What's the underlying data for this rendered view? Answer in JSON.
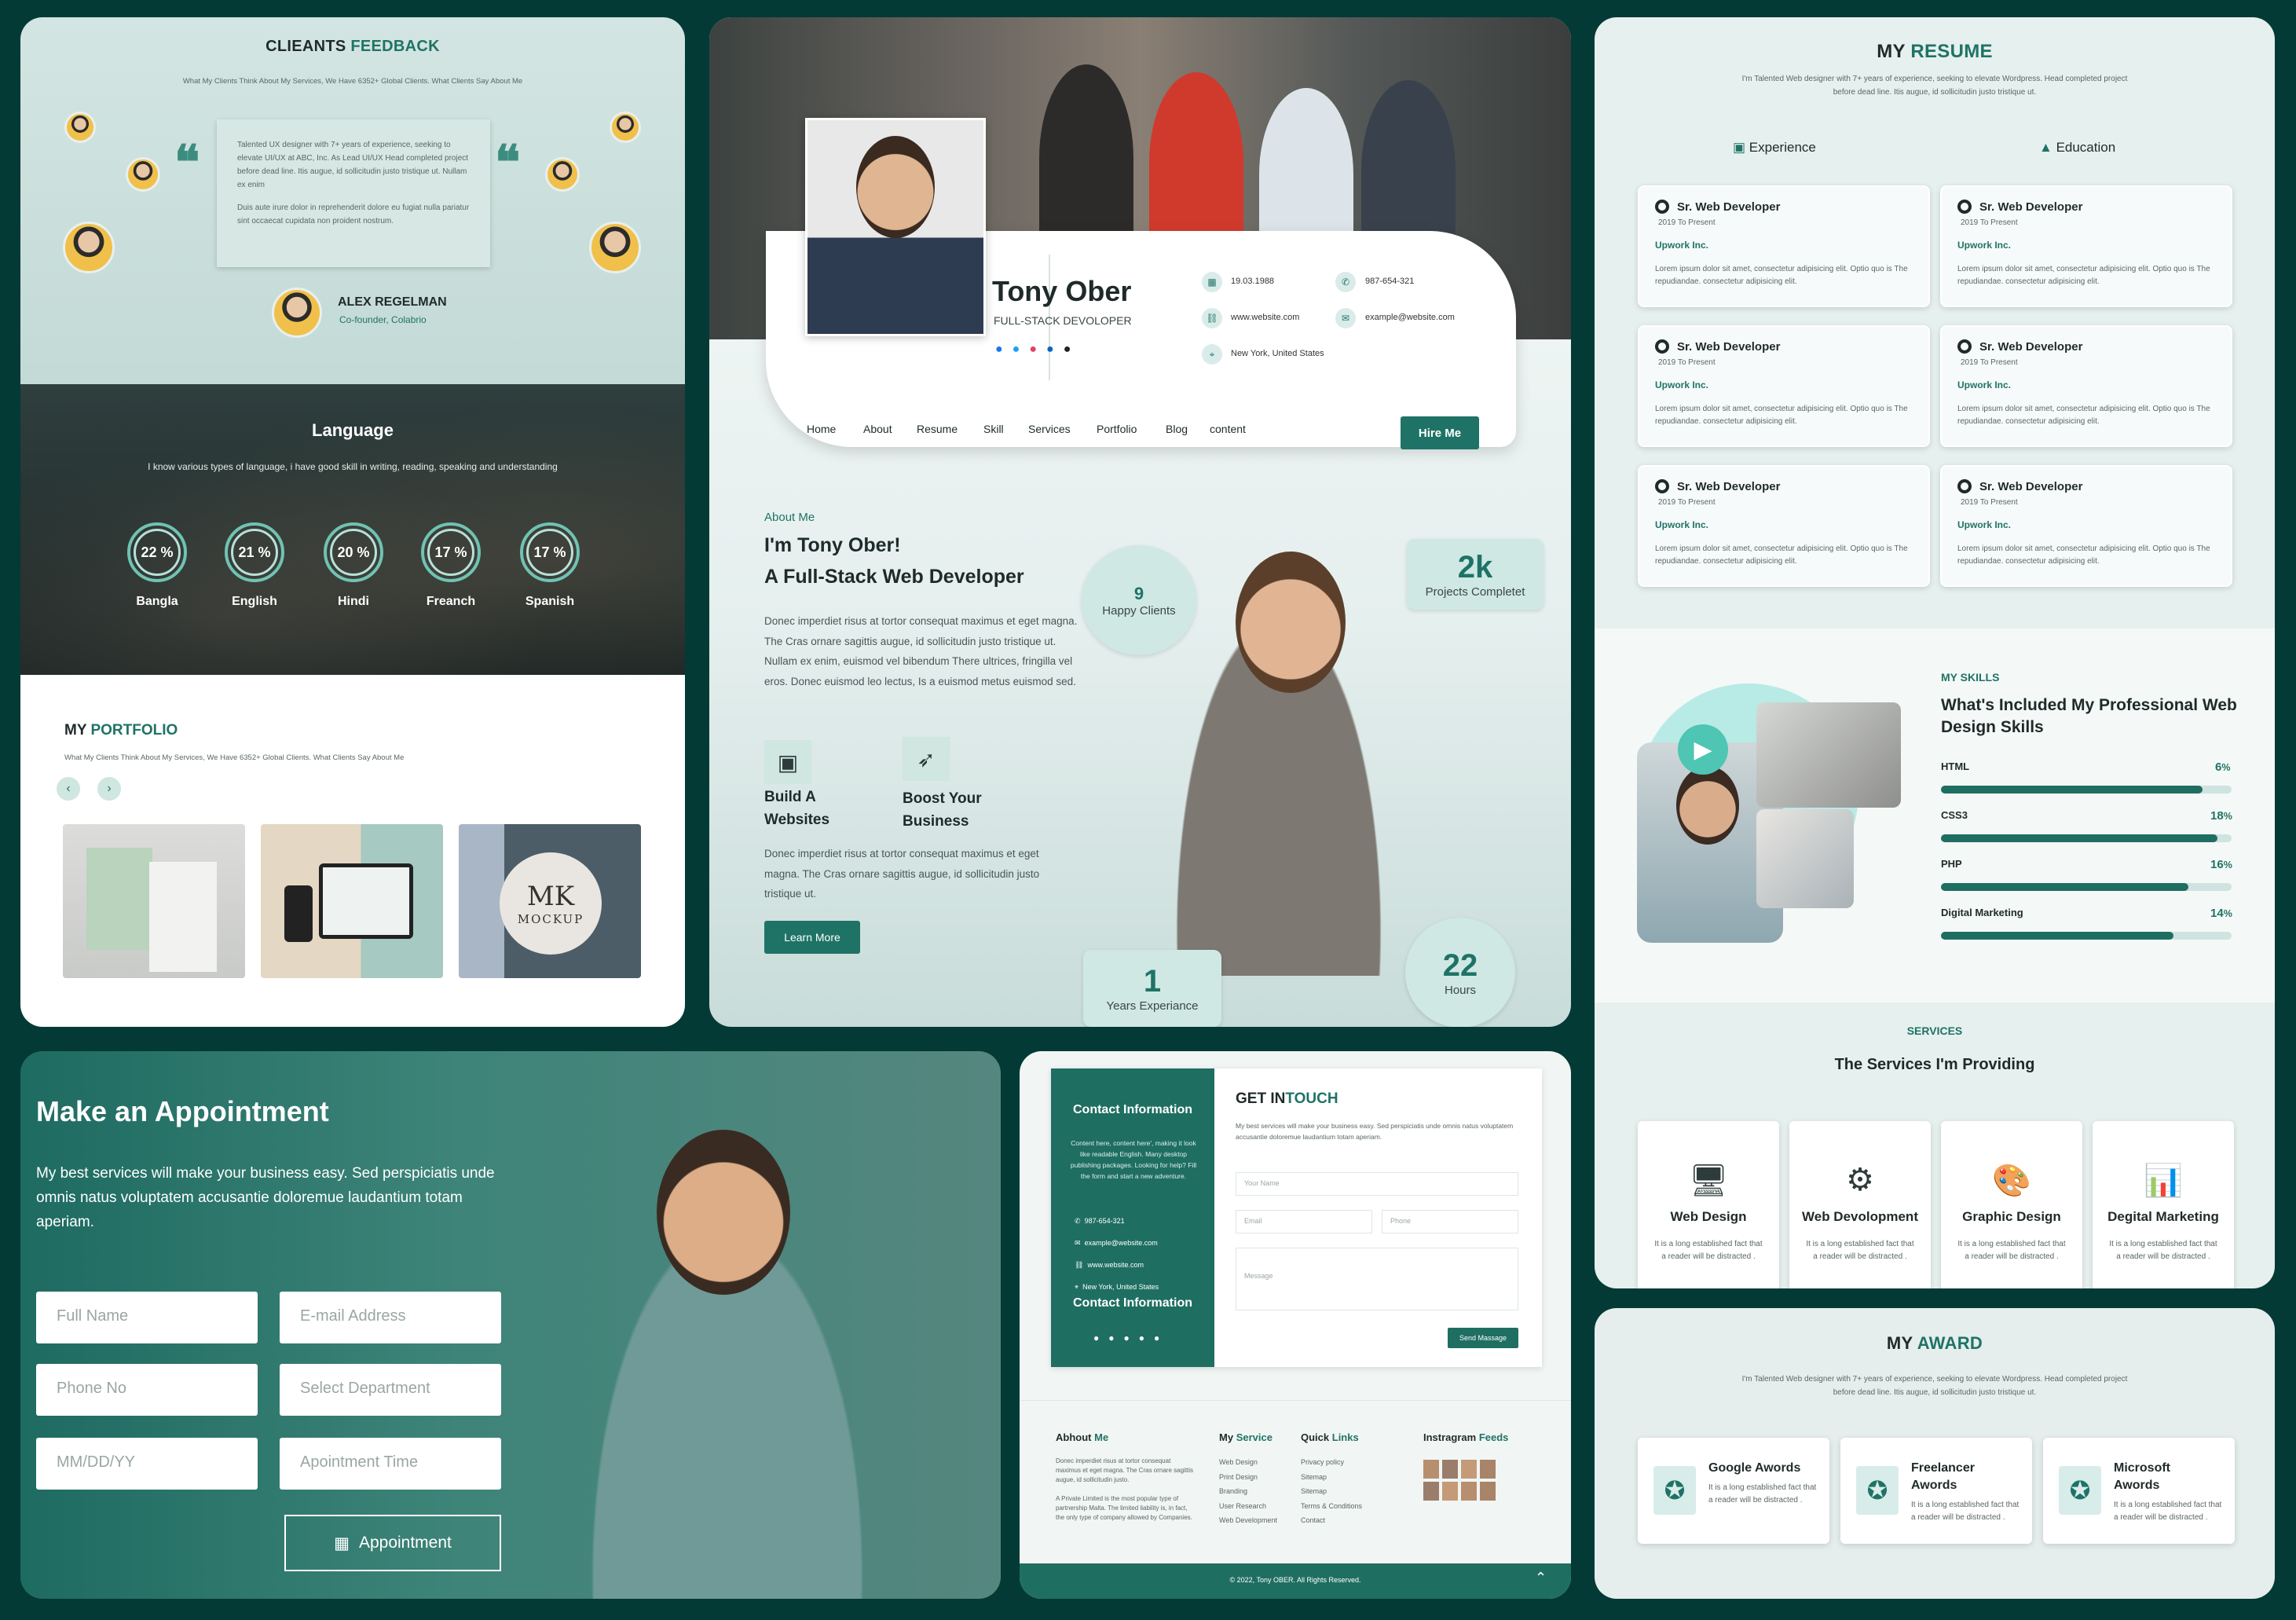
{
  "feedback": {
    "title_a": "CLIEANTS",
    "title_b": "FEEDBACK",
    "subtitle": "What My Clients Think About My Services, We Have 6352+ Global Clients. What Clients Say About Me",
    "quote_p1": "Talented UX designer with 7+ years of experience, seeking to elevate UI/UX at ABC, Inc. As Lead UI/UX Head completed project before dead line. Itis augue, id sollicitudin justo tristique ut. Nullam ex enim",
    "quote_p2": "Duis aute irure dolor in reprehenderit dolore eu fugiat nulla pariatur sint occaecat cupidata non proident nostrum.",
    "author": "ALEX REGELMAN",
    "author_role": "Co-founder, Colabrio"
  },
  "language": {
    "title": "Language",
    "subtitle": "I know various types of language, i have good skill in writing, reading, speaking and understanding",
    "items": [
      {
        "label": "Bangla",
        "value": "22 %"
      },
      {
        "label": "English",
        "value": "21 %"
      },
      {
        "label": "Hindi",
        "value": "20 %"
      },
      {
        "label": "Freanch",
        "value": "17 %"
      },
      {
        "label": "Spanish",
        "value": "17 %"
      }
    ]
  },
  "portfolio": {
    "title_a": "MY",
    "title_b": "PORTFOLIO",
    "subtitle": "What My Clients Think About My Services, We Have 6352+ Global Clients. What Clients Say About Me",
    "prev": "‹",
    "next": "›",
    "mockup_text": "MK",
    "mockup_sub": "MOCKUP"
  },
  "profile": {
    "name": "Tony Ober",
    "role": "FULL-STACK DEVOLOPER",
    "dob": "19.03.1988",
    "phone": "987-654-321",
    "website": "www.website.com",
    "email": "example@website.com",
    "location": "New York, United States",
    "nav": [
      "Home",
      "About",
      "Resume",
      "Skill",
      "Services",
      "Portfolio",
      "Blog",
      "content"
    ],
    "hire": "Hire Me"
  },
  "about": {
    "label": "About Me",
    "heading1": "I'm Tony Ober!",
    "heading2": "A Full-Stack Web Developer",
    "para": "Donec imperdiet risus at tortor consequat maximus et eget magna. The Cras ornare sagittis augue, id sollicitudin justo tristique ut. Nullam ex enim, euismod vel bibendum There ultrices, fringilla vel eros. Donec euismod leo lectus, Is a euismod metus euismod sed.",
    "feat1": "Build A Websites",
    "feat2": "Boost Your Business",
    "para2": "Donec imperdiet risus at tortor consequat maximus et eget magna. The Cras ornare sagittis augue, id sollicitudin justo tristique ut.",
    "learn": "Learn More",
    "stats": [
      {
        "n": "9",
        "l": "Happy Clients"
      },
      {
        "n": "2k",
        "l": "Projects Completet"
      },
      {
        "n": "1",
        "l": "Years Experiance"
      },
      {
        "n": "22",
        "l": "Hours"
      }
    ]
  },
  "resume": {
    "title_a": "MY",
    "title_b": "RESUME",
    "subtitle": "I'm Talented Web designer with 7+ years of experience, seeking to elevate Wordpress. Head completed project before dead line. Itis augue, id sollicitudin justo tristique ut.",
    "tab_exp": "Experience",
    "tab_edu": "Education",
    "card_title": "Sr. Web Developer",
    "card_date": "2019 To Present",
    "card_company": "Upwork Inc.",
    "card_text": "Lorem ipsum dolor sit amet, consectetur adipisicing elit. Optio quo is The repudiandae. consectetur adipisicing elit."
  },
  "skills": {
    "label": "MY SKILLS",
    "heading": "What's Included My Professional Web Design Skills",
    "items": [
      {
        "name": "HTML",
        "pct": "6",
        "fill": 0.9
      },
      {
        "name": "CSS3",
        "pct": "18",
        "fill": 0.95
      },
      {
        "name": "PHP",
        "pct": "16",
        "fill": 0.85
      },
      {
        "name": "Digital Marketing",
        "pct": "14",
        "fill": 0.8
      }
    ],
    "pct_sign": "%"
  },
  "services": {
    "label": "SERVICES",
    "heading": "The Services I'm Providing",
    "desc": "It is a long established fact that a reader will be distracted .",
    "items": [
      {
        "name": "Web Design",
        "icon": "monitor-icon"
      },
      {
        "name": "Web Devolopment",
        "icon": "gear-icon"
      },
      {
        "name": "Graphic Design",
        "icon": "palette-icon"
      },
      {
        "name": "Degital Marketing",
        "icon": "chart-icon"
      }
    ]
  },
  "award": {
    "title_a": "MY",
    "title_b": "AWARD",
    "subtitle": "I'm Talented Web designer with 7+ years of experience, seeking to elevate Wordpress. Head completed project before dead line. Itis augue, id sollicitudin justo tristique ut.",
    "desc": "It is a long established fact that a reader will be distracted .",
    "items": [
      "Google Awords",
      "Freelancer Awords",
      "Microsoft Awords"
    ]
  },
  "appointment": {
    "title": "Make an Appointment",
    "text": "My best services will make your business easy. Sed perspiciatis unde omnis natus voluptatem accusantie doloremue laudantium totam aperiam.",
    "full_name": "Full Name",
    "email": "E-mail Address",
    "phone": "Phone No",
    "dept": "Select Department",
    "date": "MM/DD/YY",
    "time": "Apointment Time",
    "button": "Appointment"
  },
  "contact": {
    "info_title": "Contact Information",
    "info_text": "Content here, content here', making it look like readable English. Many desktop publishing packages. Looking for help? Fill the form and start a new adventure.",
    "phone": "987-654-321",
    "email": "example@website.com",
    "website": "www.website.com",
    "location": "New York, United States",
    "info_title2": "Contact Information",
    "get_a": "GET IN",
    "get_b": "TOUCH",
    "get_text": "My best services will make your business easy. Sed perspiciatis unde omnis natus voluptatem accusantie doloremue laudantium totam aperiam.",
    "ph_name": "Your Name",
    "ph_email": "Email",
    "ph_phone": "Phone",
    "ph_msg": "Message",
    "send": "Send Massage"
  },
  "footer": {
    "about_a": "Abhout",
    "about_b": "Me",
    "about_p1": "Donec imperdiet risus at tortor consequat maximus et eget magna. The Cras ornare sagittis augue, id sollicitudin justo.",
    "about_p2": "A Private Limited is the most popular type of partnership Malta. The limited liability is, in fact, the only type of company allowed by Companies.",
    "svc_a": "My",
    "svc_b": "Service",
    "svc_items": [
      "Web Design",
      "Print Design",
      "Branding",
      "User Research",
      "Web Development"
    ],
    "links_a": "Quick",
    "links_b": "Links",
    "links_items": [
      "Privacy policy",
      "Sitemap",
      "Sitemap",
      "Terms & Conditions",
      "Contact"
    ],
    "insta_a": "Instragram",
    "insta_b": "Feeds",
    "copyright": "© 2022, Tony OBER. All Rights Reserved.",
    "up": "⌃"
  },
  "colors": {
    "accent": "#1f7366",
    "background": "#033a35"
  }
}
